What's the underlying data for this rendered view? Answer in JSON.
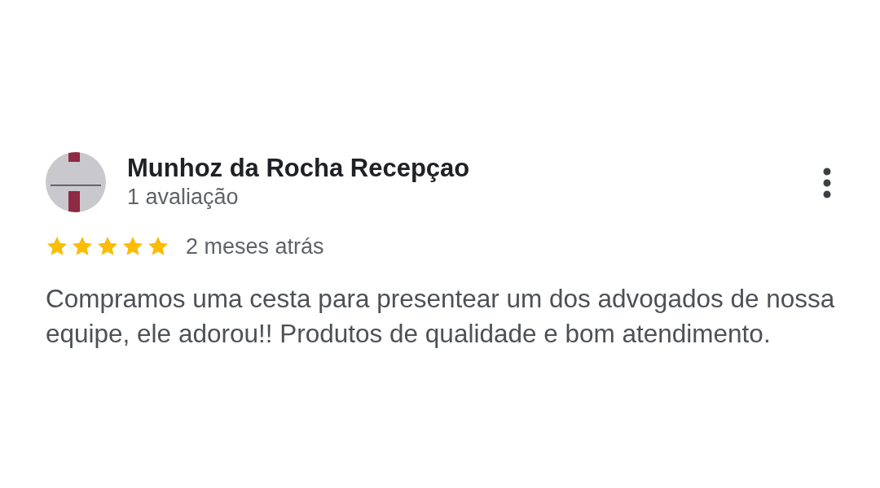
{
  "review": {
    "author": {
      "name": "Munhoz da Rocha Recepçao",
      "review_count": "1 avaliação"
    },
    "stars": 5,
    "time": "2 meses atrás",
    "text": "Compramos uma cesta para presentear um dos advogados de nossa equipe, ele adorou!! Produtos de qualidade e bom atendimento."
  }
}
